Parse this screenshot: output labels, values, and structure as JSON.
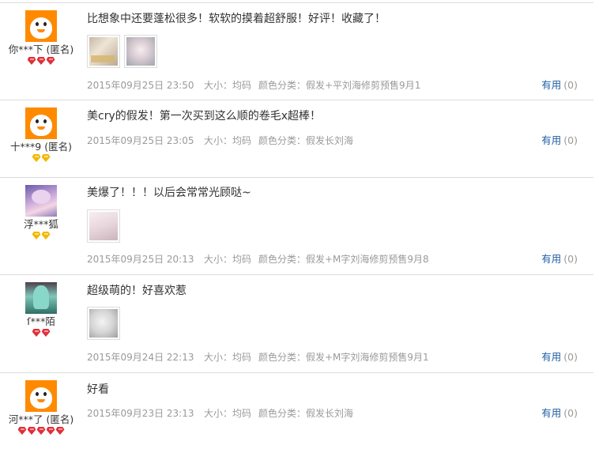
{
  "reviews": [
    {
      "username": "你***下 (匿名)",
      "avatar": "orange-mascot-avatar",
      "rank_gems": [
        "red",
        "red",
        "red"
      ],
      "content": "比想象中还要蓬松很多！软软的摸着超舒服！好评！收藏了！",
      "photos": [
        "photo-cosplay-wig-1",
        "photo-cosplay-wig-2"
      ],
      "date": "2015年09月25日 23:50",
      "size": "大小：均码",
      "color": "颜色分类：假发+平刘海修剪预售9月1",
      "useful_label": "有用",
      "useful_count": "(0)"
    },
    {
      "username": "十***9 (匿名)",
      "avatar": "orange-mascot-avatar",
      "rank_gems": [
        "gold",
        "gold"
      ],
      "content": "美cry的假发！第一次买到这么顺的卷毛x超棒！",
      "photos": [],
      "date": "2015年09月25日 23:05",
      "size": "大小：均码",
      "color": "颜色分类：假发长刘海",
      "useful_label": "有用",
      "useful_count": "(0)"
    },
    {
      "username": "浮***狐",
      "avatar": "anime-avatar-purple",
      "rank_gems": [
        "gold",
        "gold"
      ],
      "content": "美爆了！！！以后会常常光顾哒~",
      "photos": [
        "photo-wig-3"
      ],
      "date": "2015年09月25日 20:13",
      "size": "大小：均码",
      "color": "颜色分类：假发+M字刘海修剪预售9月8",
      "useful_label": "有用",
      "useful_count": "(0)"
    },
    {
      "username": "ſ***陌",
      "avatar": "anime-avatar-green",
      "rank_gems": [
        "red",
        "red"
      ],
      "content": "超级萌的！好喜欢惹",
      "photos": [
        "photo-wig-4"
      ],
      "date": "2015年09月24日 22:13",
      "size": "大小：均码",
      "color": "颜色分类：假发+M字刘海修剪预售9月1",
      "useful_label": "有用",
      "useful_count": "(0)"
    },
    {
      "username": "河***了 (匿名)",
      "avatar": "orange-mascot-avatar",
      "rank_gems": [
        "red",
        "red",
        "red",
        "red",
        "red"
      ],
      "content": "好看",
      "photos": [],
      "date": "2015年09月23日 23:13",
      "size": "大小：均码",
      "color": "颜色分类：假发长刘海",
      "useful_label": "有用",
      "useful_count": "(0)"
    }
  ]
}
